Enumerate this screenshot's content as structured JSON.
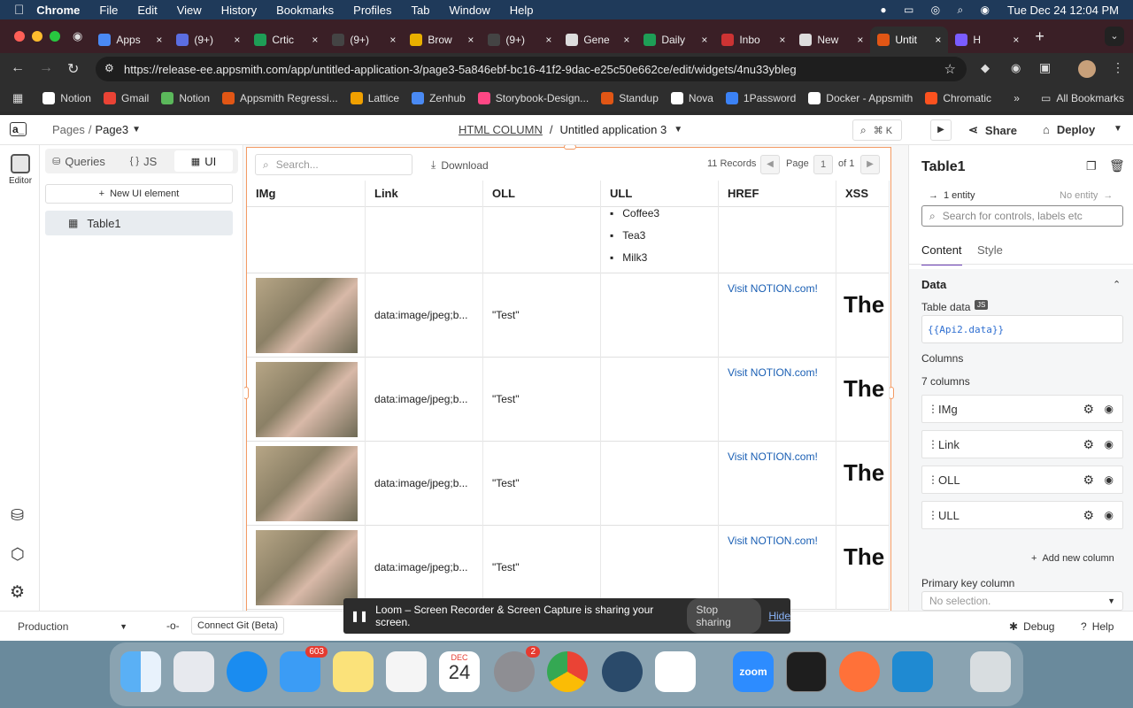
{
  "menubar": {
    "app": "Chrome",
    "items": [
      "File",
      "Edit",
      "View",
      "History",
      "Bookmarks",
      "Profiles",
      "Tab",
      "Window",
      "Help"
    ],
    "datetime": "Tue Dec 24  12:04 PM"
  },
  "tabs": [
    {
      "label": "Apps",
      "color": "#4a8af4"
    },
    {
      "label": "(9+)",
      "color": "#5b6ee1"
    },
    {
      "label": "Crtic",
      "color": "#1e9e56"
    },
    {
      "label": "(9+)",
      "color": "#444"
    },
    {
      "label": "Brow",
      "color": "#e8b000"
    },
    {
      "label": "(9+)",
      "color": "#444"
    },
    {
      "label": "Gene",
      "color": "#ddd"
    },
    {
      "label": "Daily",
      "color": "#1e9e56"
    },
    {
      "label": "Inbo",
      "color": "#c33"
    },
    {
      "label": "New",
      "color": "#ddd"
    },
    {
      "label": "Untit",
      "color": "#e15615"
    },
    {
      "label": "H",
      "color": "#7a5cff"
    }
  ],
  "address": {
    "url": "https://release-ee.appsmith.com/app/untitled-application-3/page3-5a846ebf-bc16-41f2-9dac-e25c50e662ce/edit/widgets/4nu33ybleg"
  },
  "bookmarks": [
    {
      "label": "Notion",
      "color": "#fff"
    },
    {
      "label": "Gmail",
      "color": "#ea4335"
    },
    {
      "label": "Notion",
      "color": "#5bb85b"
    },
    {
      "label": "Appsmith Regressi...",
      "color": "#e15615"
    },
    {
      "label": "Lattice",
      "color": "#f0a000"
    },
    {
      "label": "Zenhub",
      "color": "#4a8af4"
    },
    {
      "label": "Storybook-Design...",
      "color": "#ff4785"
    },
    {
      "label": "Standup",
      "color": "#e15615"
    },
    {
      "label": "Nova",
      "color": "#fff"
    },
    {
      "label": "1Password",
      "color": "#3b82f6"
    },
    {
      "label": "Docker - Appsmith",
      "color": "#fff"
    },
    {
      "label": "Chromatic",
      "color": "#fc521f"
    }
  ],
  "bookmarks_all": "All Bookmarks",
  "header": {
    "pages_label": "Pages",
    "page_sep": "/",
    "current_page": "Page3",
    "breadcrumb_app": "HTML COLUMN",
    "breadcrumb_sep": "/",
    "app_name": "Untitled application 3",
    "search_shortcut": "⌘ K",
    "share": "Share",
    "deploy": "Deploy",
    "logo": "a_"
  },
  "rail": {
    "editor": "Editor"
  },
  "explorer": {
    "tabs": [
      "Queries",
      "JS",
      "UI"
    ],
    "new_button": "New UI element",
    "widget": "Table1"
  },
  "table": {
    "search_placeholder": "Search...",
    "download": "Download",
    "records": "11 Records",
    "page_label": "Page",
    "page_num": "1",
    "page_of": "of 1",
    "columns": [
      "IMg",
      "Link",
      "OLL",
      "ULL",
      "HREF",
      "XSS"
    ],
    "first_row_list": [
      "Coffee3",
      "Tea3",
      "Milk3"
    ],
    "rows": [
      {
        "link": "data:image/jpeg;b...",
        "oll": "\"Test\"",
        "href": "Visit NOTION.com!",
        "xss": "The"
      },
      {
        "link": "data:image/jpeg;b...",
        "oll": "\"Test\"",
        "href": "Visit NOTION.com!",
        "xss": "The"
      },
      {
        "link": "data:image/jpeg;b...",
        "oll": "\"Test\"",
        "href": "Visit NOTION.com!",
        "xss": "The"
      },
      {
        "link": "data:image/jpeg;b...",
        "oll": "\"Test\"",
        "href": "Visit NOTION.com!",
        "xss": "The"
      }
    ]
  },
  "props": {
    "title": "Table1",
    "entity": "1 entity",
    "no_entity": "No entity",
    "search_placeholder": "Search for controls, labels etc",
    "tabs": [
      "Content",
      "Style"
    ],
    "section": "Data",
    "table_data_label": "Table data",
    "js_badge": "JS",
    "table_data_value": "{{Api2.data}}",
    "columns_label": "Columns",
    "columns_count": "7 columns",
    "columns": [
      "IMg",
      "Link",
      "OLL",
      "ULL"
    ],
    "add_column": "Add new column",
    "primary_key_label": "Primary key column",
    "primary_key_value": "No selection."
  },
  "bottom": {
    "env": "Production",
    "git": "Connect Git (Beta)",
    "debug": "Debug",
    "help": "Help"
  },
  "loom": {
    "text": "Loom – Screen Recorder & Screen Capture is sharing your screen.",
    "stop": "Stop sharing",
    "hide": "Hide"
  },
  "dock": {
    "mail_badge": "603",
    "settings_badge": "2",
    "cal_month": "DEC",
    "cal_day": "24",
    "zoom": "zoom"
  }
}
